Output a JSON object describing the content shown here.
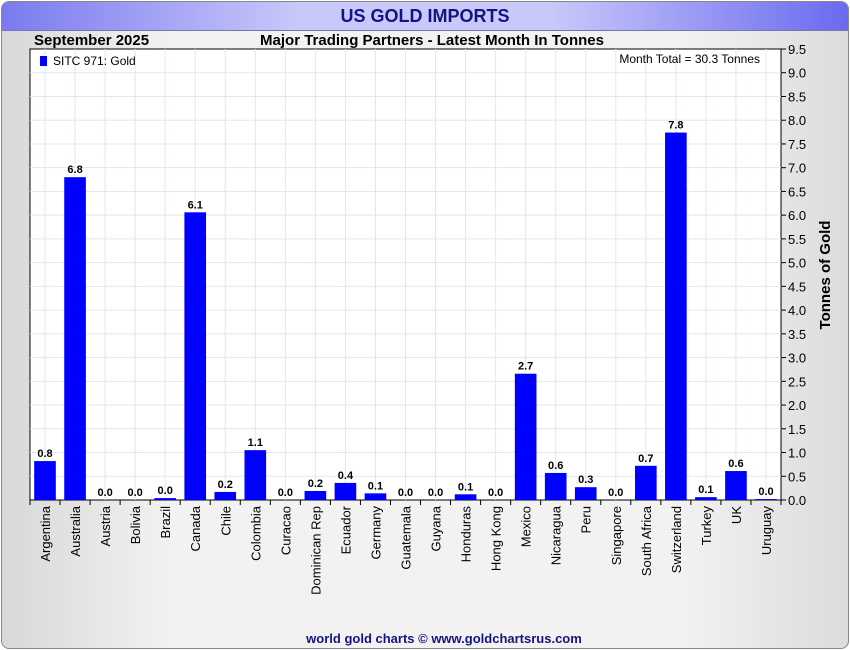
{
  "title": "US GOLD IMPORTS",
  "footer": "world gold charts © www.goldchartsrus.com",
  "chart_data": {
    "type": "bar",
    "title": "Major Trading Partners - Latest Month In Tonnes",
    "period": "September 2025",
    "annotation": "Month Total = 30.3 Tonnes",
    "legend": [
      {
        "name": "SITC 971: Gold",
        "color": "#0000ff"
      }
    ],
    "legend_position": "top-left",
    "xlabel": "",
    "ylabel": "Tonnes of Gold",
    "ylim": [
      0,
      9.5
    ],
    "ytick_step": 0.5,
    "grid": true,
    "categories": [
      "Argentina",
      "Australia",
      "Austria",
      "Bolivia",
      "Brazil",
      "Canada",
      "Chile",
      "Colombia",
      "Curacao",
      "Dominican Rep",
      "Ecuador",
      "Germany",
      "Guatemala",
      "Guyana",
      "Honduras",
      "Hong Kong",
      "Mexico",
      "Nicaragua",
      "Peru",
      "Singapore",
      "South Africa",
      "Switzerland",
      "Turkey",
      "UK",
      "Uruguay"
    ],
    "values": [
      0.82,
      6.8,
      0.0,
      0.0,
      0.04,
      6.06,
      0.17,
      1.05,
      0.0,
      0.19,
      0.36,
      0.14,
      0.0,
      0.0,
      0.12,
      0.0,
      2.66,
      0.57,
      0.27,
      0.0,
      0.72,
      7.74,
      0.06,
      0.61,
      0.02
    ],
    "labels": [
      "0.8",
      "6.8",
      "0.0",
      "0.0",
      "0.0",
      "6.1",
      "0.2",
      "1.1",
      "0.0",
      "0.2",
      "0.4",
      "0.1",
      "0.0",
      "0.0",
      "0.1",
      "0.0",
      "2.7",
      "0.6",
      "0.3",
      "0.0",
      "0.7",
      "7.8",
      "0.1",
      "0.6",
      "0.0"
    ],
    "bar_color": "#0000ff"
  }
}
